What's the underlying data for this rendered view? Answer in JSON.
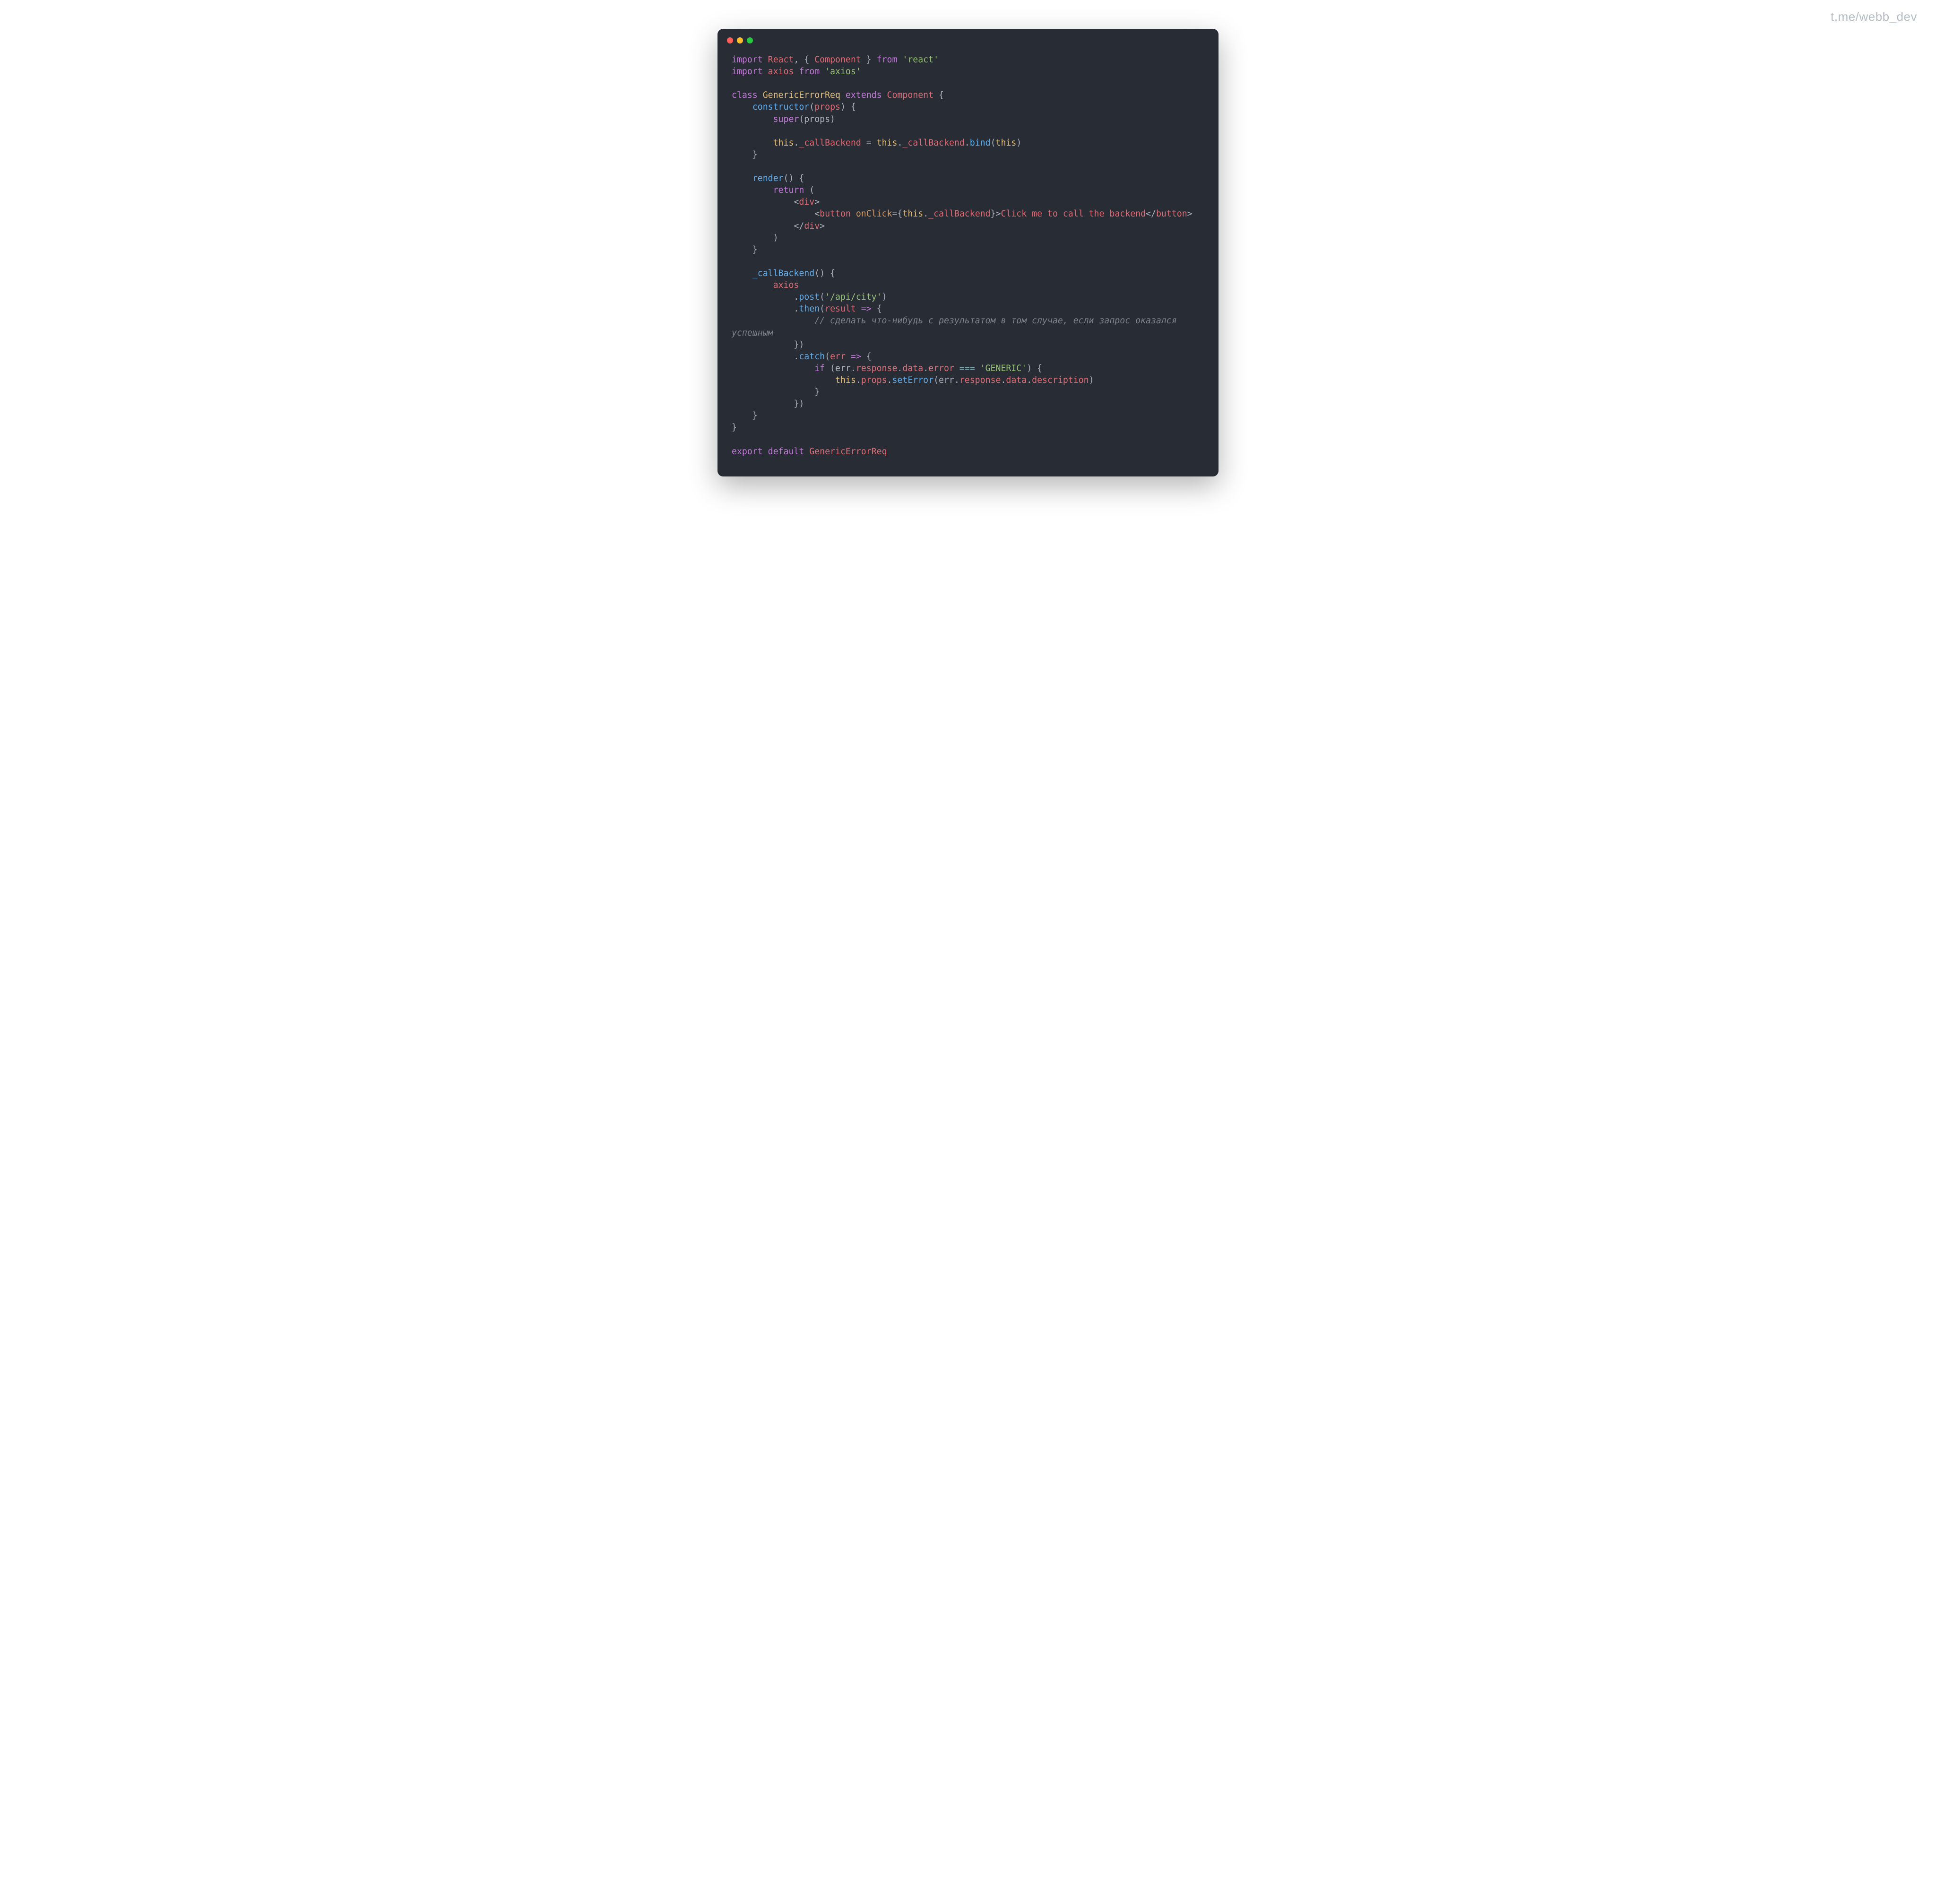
{
  "watermark": "t.me/webb_dev",
  "code": {
    "l1": {
      "a": "import",
      "b": " React",
      "c": ", { ",
      "d": "Component",
      "e": " } ",
      "f": "from",
      "g": " ",
      "h": "'react'"
    },
    "l2": {
      "a": "import",
      "b": " axios ",
      "c": "from",
      "d": " ",
      "e": "'axios'"
    },
    "l3": "",
    "l4": {
      "a": "class",
      "b": " ",
      "c": "GenericErrorReq",
      "d": " ",
      "e": "extends",
      "f": " ",
      "g": "Component",
      "h": " {"
    },
    "l5": {
      "a": "    ",
      "b": "constructor",
      "c": "(",
      "d": "props",
      "e": ") {"
    },
    "l6": {
      "a": "        ",
      "b": "super",
      "c": "(props)"
    },
    "l7": "",
    "l8": {
      "a": "        ",
      "b": "this",
      "c": ".",
      "d": "_callBackend",
      "e": " = ",
      "f": "this",
      "g": ".",
      "h": "_callBackend",
      "i": ".",
      "j": "bind",
      "k": "(",
      "l": "this",
      "m": ")"
    },
    "l9": "    }",
    "l10": "",
    "l11": {
      "a": "    ",
      "b": "render",
      "c": "() {"
    },
    "l12": {
      "a": "        ",
      "b": "return",
      "c": " ("
    },
    "l13": {
      "a": "            <",
      "b": "div",
      "c": ">"
    },
    "l14": {
      "a": "                <",
      "b": "button",
      "c": " ",
      "d": "onClick",
      "e": "=",
      "f": "{",
      "g": "this",
      "h": ".",
      "i": "_callBackend",
      "j": "}",
      "k": ">",
      "l": "Click me to call the backend",
      "m": "</",
      "n": "button",
      "o": ">"
    },
    "l15": {
      "a": "            </",
      "b": "div",
      "c": ">"
    },
    "l16": "        )",
    "l17": "    }",
    "l18": "",
    "l19": {
      "a": "    ",
      "b": "_callBackend",
      "c": "() {"
    },
    "l20": {
      "a": "        ",
      "b": "axios"
    },
    "l21": {
      "a": "            .",
      "b": "post",
      "c": "(",
      "d": "'/api/city'",
      "e": ")"
    },
    "l22": {
      "a": "            .",
      "b": "then",
      "c": "(",
      "d": "result",
      "e": " ",
      "f": "=>",
      "g": " {"
    },
    "l23": {
      "a": "                ",
      "b": "// сделать что-нибудь с результатом в том случае, если запрос оказался успешным"
    },
    "l24": "            })",
    "l25": {
      "a": "            .",
      "b": "catch",
      "c": "(",
      "d": "err",
      "e": " ",
      "f": "=>",
      "g": " {"
    },
    "l26": {
      "a": "                ",
      "b": "if",
      "c": " (err.",
      "d": "response",
      "e": ".",
      "f": "data",
      "g": ".",
      "h": "error",
      "i": " ",
      "j": "===",
      "k": " ",
      "l": "'GENERIC'",
      "m": ") {"
    },
    "l27": {
      "a": "                    ",
      "b": "this",
      "c": ".",
      "d": "props",
      "e": ".",
      "f": "setError",
      "g": "(err.",
      "h": "response",
      "i": ".",
      "j": "data",
      "k": ".",
      "l": "description",
      "m": ")"
    },
    "l28": "                }",
    "l29": "            })",
    "l30": "    }",
    "l31": "}",
    "l32": "",
    "l33": {
      "a": "export",
      "b": " ",
      "c": "default",
      "d": " ",
      "e": "GenericErrorReq"
    }
  }
}
